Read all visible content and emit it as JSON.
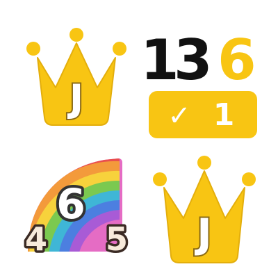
{
  "tiles": {
    "crown_top": {
      "letter": "J"
    },
    "score": {
      "digit_1": "1",
      "digit_2": "3",
      "digit_3": "6",
      "badge_check": "✓",
      "badge_count": "1"
    },
    "rainbow": {
      "digit_top": "6",
      "digit_left": "4",
      "digit_right": "5"
    },
    "crown_bottom": {
      "letter": "J"
    }
  },
  "colors": {
    "crown_gold": "#F8C513",
    "crown_outline": "#A8810A",
    "letter_fill": "#FFFFFF",
    "letter_outline": "#8A6A14",
    "score_black": "#111111",
    "score_gold": "#F8C513",
    "badge_text": "#FFFFFF",
    "digit_fill": "#F7EADB",
    "digit_outline": "#3A2A24",
    "digit_top_fill": "#FFFFFF",
    "digit_top_outline": "#333333",
    "rainbow": [
      "#E94E4E",
      "#F39A3B",
      "#F7D23C",
      "#7BC950",
      "#3FB6D6",
      "#4C7FE0",
      "#A85BD6",
      "#E56CC4"
    ]
  }
}
